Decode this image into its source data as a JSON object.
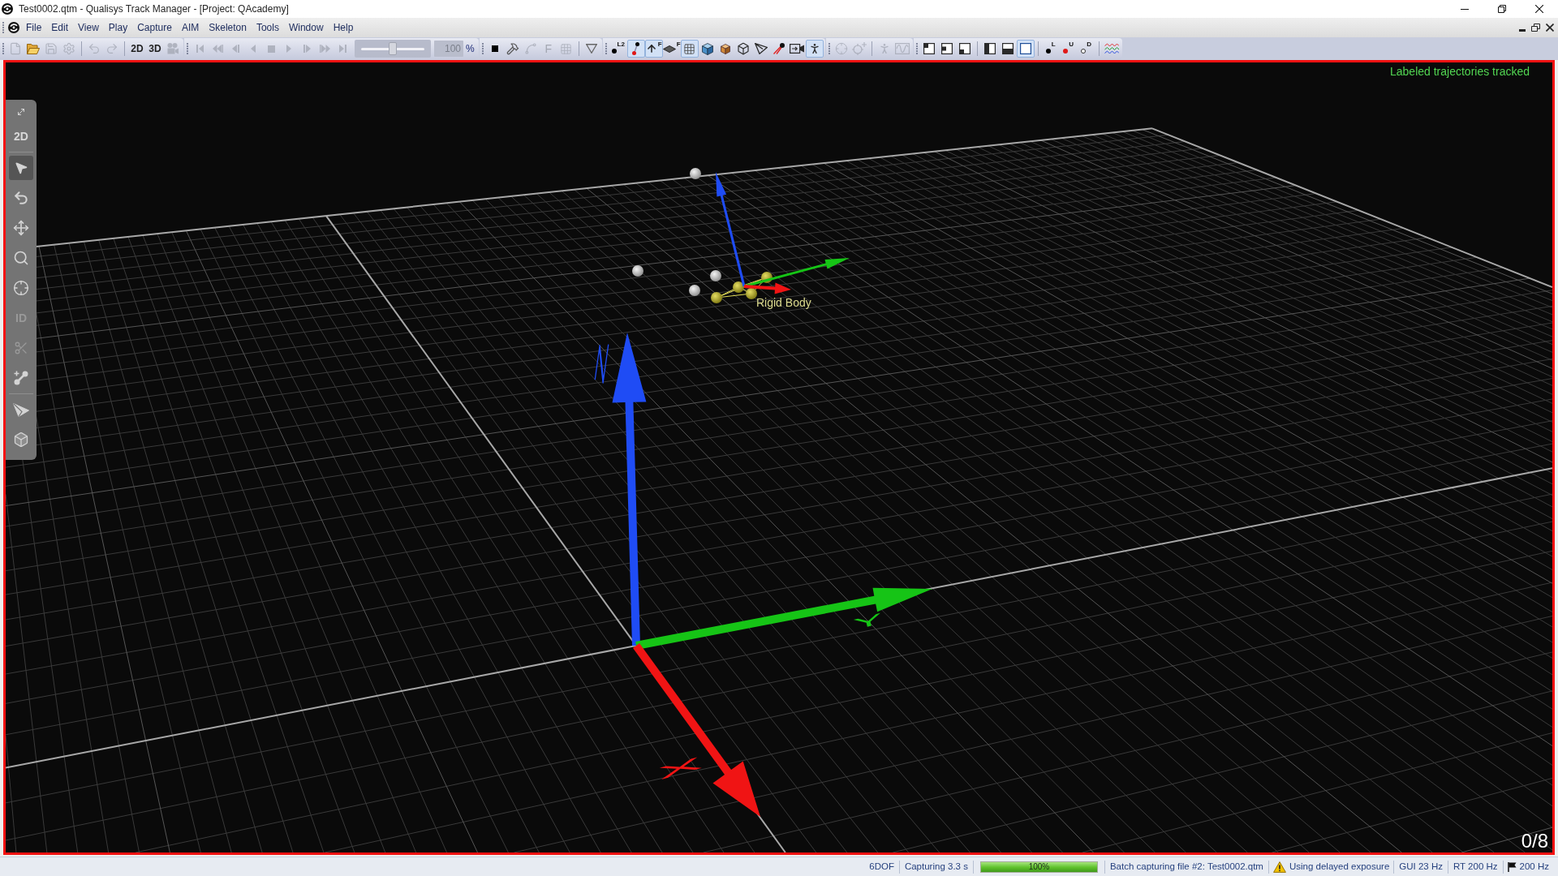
{
  "window": {
    "title": "Test0002.qtm - Qualisys Track Manager - [Project: QAcademy]"
  },
  "menu": [
    "File",
    "Edit",
    "View",
    "Play",
    "Capture",
    "AIM",
    "Skeleton",
    "Tools",
    "Window",
    "Help"
  ],
  "toolbar": [
    [
      [
        {
          "kind": "button",
          "disabled": true
        },
        {
          "kind": "button",
          "disabled": false
        },
        {
          "kind": "button",
          "disabled": true
        },
        {
          "kind": "button",
          "disabled": true
        }
      ],
      [
        {
          "kind": "button",
          "disabled": true
        },
        {
          "kind": "button",
          "disabled": true
        }
      ],
      [
        {
          "kind": "button",
          "label": "2D",
          "disabled": false
        },
        {
          "kind": "button",
          "label": "3D",
          "disabled": false
        },
        {
          "kind": "button",
          "disabled": true
        }
      ]
    ],
    [
      [
        {
          "kind": "button",
          "disabled": true
        },
        {
          "kind": "button",
          "disabled": true
        },
        {
          "kind": "button",
          "disabled": true
        },
        {
          "kind": "button",
          "disabled": true
        },
        {
          "kind": "button",
          "disabled": true
        },
        {
          "kind": "button",
          "disabled": true
        },
        {
          "kind": "button",
          "disabled": true
        },
        {
          "kind": "button",
          "disabled": true
        },
        {
          "kind": "button",
          "disabled": true
        },
        {
          "kind": "slider",
          "level": 0.5,
          "disabled": true
        },
        {
          "kind": "field",
          "value": "100",
          "disabled": true
        },
        {
          "kind": "text",
          "label": "%"
        }
      ]
    ],
    [
      [
        {
          "kind": "button",
          "disabled": false
        },
        {
          "kind": "button",
          "disabled": false
        },
        {
          "kind": "button",
          "disabled": true
        },
        {
          "kind": "button",
          "label": "F",
          "disabled": true
        },
        {
          "kind": "button",
          "disabled": true
        }
      ],
      [
        {
          "kind": "button",
          "disabled": false
        }
      ]
    ],
    [
      [
        {
          "kind": "button",
          "badge": "L2",
          "selected": false,
          "disabled": false
        },
        {
          "kind": "button",
          "selected": true,
          "disabled": false
        },
        {
          "kind": "button",
          "badge": "F",
          "selected": true,
          "disabled": false
        },
        {
          "kind": "button",
          "badge": "F",
          "selected": false,
          "disabled": false
        },
        {
          "kind": "button",
          "selected": true,
          "disabled": false
        },
        {
          "kind": "button",
          "selected": false,
          "disabled": false
        },
        {
          "kind": "button",
          "selected": false,
          "disabled": false
        },
        {
          "kind": "button",
          "selected": false,
          "disabled": false
        },
        {
          "kind": "button",
          "selected": false,
          "disabled": false
        },
        {
          "kind": "button",
          "selected": false,
          "disabled": false
        },
        {
          "kind": "button",
          "selected": false,
          "disabled": false
        },
        {
          "kind": "button",
          "selected": true,
          "disabled": false
        }
      ]
    ],
    [
      [
        {
          "kind": "button",
          "disabled": true
        },
        {
          "kind": "button",
          "disabled": true
        }
      ],
      [
        {
          "kind": "button",
          "disabled": true
        },
        {
          "kind": "button",
          "disabled": true
        }
      ]
    ],
    [
      [
        {
          "kind": "button",
          "selected": false,
          "disabled": false
        },
        {
          "kind": "button",
          "selected": false,
          "disabled": false
        },
        {
          "kind": "button",
          "selected": false,
          "disabled": false
        }
      ],
      [
        {
          "kind": "button",
          "selected": false,
          "disabled": false
        },
        {
          "kind": "button",
          "selected": false,
          "disabled": false
        },
        {
          "kind": "button",
          "selected": true,
          "disabled": false
        }
      ],
      [
        {
          "kind": "button",
          "badge": "L",
          "disabled": false
        },
        {
          "kind": "button",
          "badge": "U",
          "disabled": false
        },
        {
          "kind": "button",
          "badge": "D",
          "disabled": false
        }
      ],
      [
        {
          "kind": "button",
          "disabled": false
        }
      ]
    ]
  ],
  "view": {
    "tools": [
      [
        {
          "selected": false,
          "disabled": false
        },
        {
          "label": "2D",
          "selected": false,
          "disabled": false
        }
      ],
      [
        {
          "selected": true,
          "disabled": false
        },
        {
          "selected": false,
          "disabled": false
        },
        {
          "selected": false,
          "disabled": false
        },
        {
          "selected": false,
          "disabled": false
        },
        {
          "selected": false,
          "disabled": false
        },
        {
          "label": "ID",
          "selected": false,
          "disabled": true
        },
        {
          "selected": false,
          "disabled": true
        },
        {
          "selected": false,
          "disabled": false
        }
      ],
      [
        {
          "selected": false,
          "disabled": false
        },
        {
          "selected": false,
          "disabled": false
        }
      ]
    ],
    "status": "Labeled trajectories tracked",
    "axes": [
      {
        "label": "X",
        "color": "#f01414"
      },
      {
        "label": "Y",
        "color": "#16c416"
      },
      {
        "label": "Z",
        "color": "#1f4cf5"
      }
    ],
    "rigid_body": {
      "name": "Rigid Body"
    },
    "frame_counter": "0/8"
  },
  "status_bar": [
    {
      "kind": "text",
      "text": "6DOF"
    },
    {
      "kind": "text",
      "text": "Capturing 3.3 s"
    },
    {
      "kind": "progress",
      "level": 1,
      "text": "100%"
    },
    {
      "kind": "text",
      "text": "Batch capturing file #2: Test0002.qtm"
    },
    {
      "kind": "warning",
      "text": "Using delayed exposure"
    },
    {
      "kind": "text",
      "text": "GUI 23 Hz"
    },
    {
      "kind": "text",
      "text": "RT 200 Hz"
    },
    {
      "kind": "flag",
      "text": "200 Hz"
    }
  ]
}
